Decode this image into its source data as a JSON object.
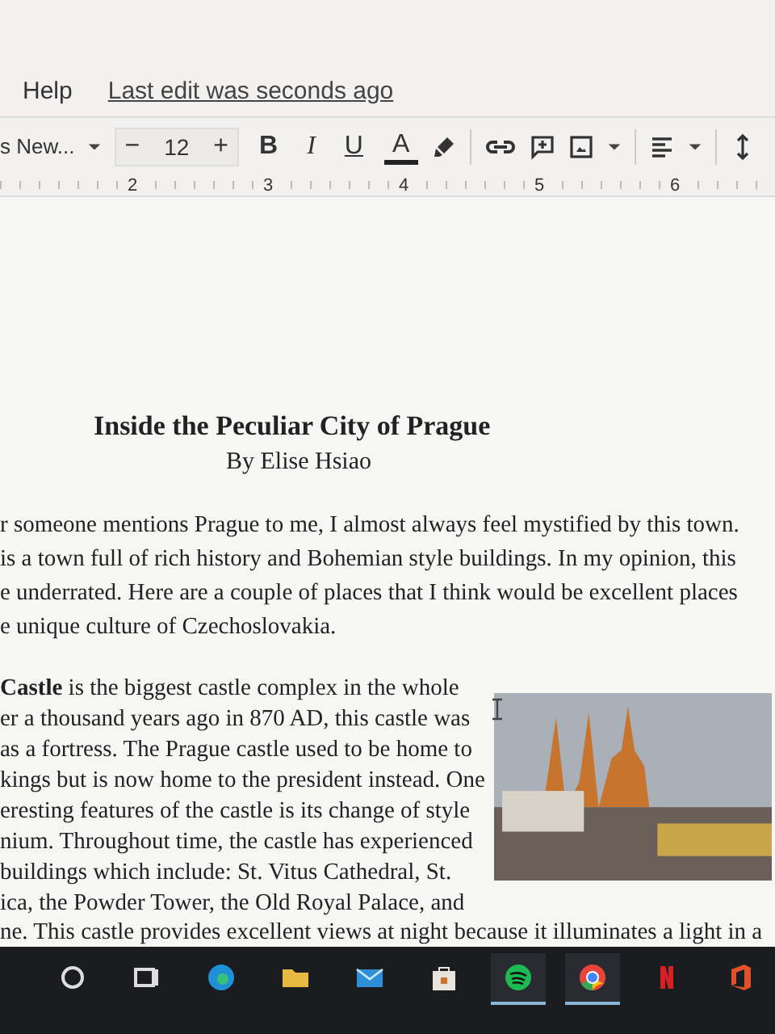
{
  "menu": {
    "items": [
      "Help"
    ],
    "last_edit": "Last edit was seconds ago"
  },
  "toolbar": {
    "font": "s New...",
    "font_size": "12",
    "minus": "−",
    "plus": "+",
    "bold": "B",
    "italic": "I",
    "underline": "U",
    "text_color": "A"
  },
  "ruler": {
    "numbers": [
      "2",
      "3",
      "4",
      "5",
      "6"
    ]
  },
  "document": {
    "title": "Inside the Peculiar City of Prague",
    "author": "By Elise Hsiao",
    "paragraph_1": [
      "r someone mentions Prague to me, I almost always feel mystified by this town.",
      "is a town full of rich history and Bohemian style buildings. In my opinion, this",
      "e underrated. Here are a couple of places that I think would be excellent places",
      "e unique culture of Czechoslovakia."
    ],
    "paragraph_2": [
      "**Castle** is the biggest castle complex in the whole",
      "er a thousand years ago in 870 AD, this castle was",
      "as a fortress. The Prague castle used to be home to",
      "kings but is now home to the president instead. One",
      "eresting features of the castle is its change of style",
      "nium. Throughout time, the castle has experienced",
      "buildings which include: St. Vitus Cathedral, St.",
      "ica, the Powder Tower, the Old Royal Palace, and"
    ],
    "last_line": "ne. This castle provides excellent views at night because it illuminates a light in a"
  },
  "taskbar": {
    "apps": [
      {
        "kind": "search",
        "running": false
      },
      {
        "kind": "taskview",
        "running": false
      },
      {
        "kind": "browser",
        "running": false
      },
      {
        "kind": "folder",
        "running": false
      },
      {
        "kind": "mail",
        "running": false
      },
      {
        "kind": "store",
        "running": false
      },
      {
        "kind": "music",
        "running": true
      },
      {
        "kind": "chrome",
        "running": true
      },
      {
        "kind": "netflix",
        "running": false
      },
      {
        "kind": "office",
        "running": false
      }
    ]
  }
}
